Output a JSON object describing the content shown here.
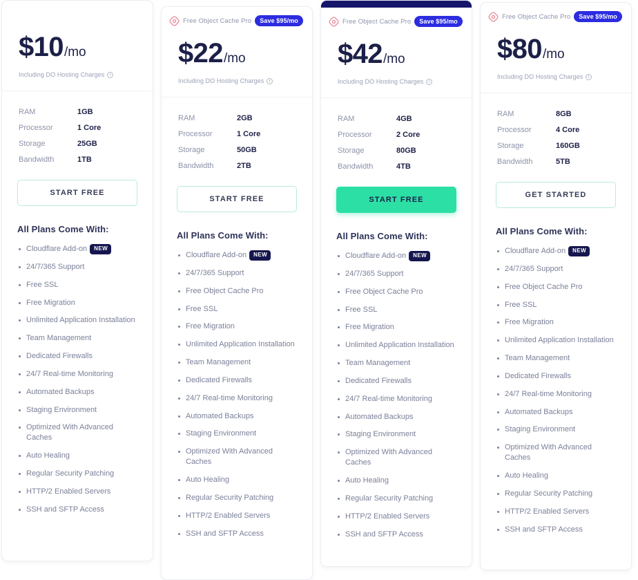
{
  "colors": {
    "accent_green": "#2ce0a5",
    "badge_blue": "#2c2ce0",
    "navy": "#16164f",
    "text_dark": "#1c2048",
    "text_muted": "#8d92a9"
  },
  "labels": {
    "price_suffix": "/mo",
    "price_note": "Including DO Hosting Charges",
    "info_icon": "i",
    "features_title": "All Plans Come With:",
    "ocp_badge_label": "Free Object Cache Pro",
    "ocp_badge_save": "Save $95/mo",
    "new_pill": "NEW",
    "spec_keys": [
      "RAM",
      "Processor",
      "Storage",
      "Bandwidth"
    ]
  },
  "plans": [
    {
      "id": "plan-10",
      "price": "$10",
      "has_ocp_badge": false,
      "highlighted": false,
      "cta": "START FREE",
      "cta_style": "outline",
      "specs": {
        "ram": "1GB",
        "processor": "1 Core",
        "storage": "25GB",
        "bandwidth": "1TB"
      },
      "features": [
        "Cloudflare Add-on",
        "24/7/365 Support",
        "Free SSL",
        "Free Migration",
        "Unlimited Application Installation",
        "Team Management",
        "Dedicated Firewalls",
        "24/7 Real-time Monitoring",
        "Automated Backups",
        "Staging Environment",
        "Optimized With Advanced Caches",
        "Auto Healing",
        "Regular Security Patching",
        "HTTP/2 Enabled Servers",
        "SSH and SFTP Access"
      ]
    },
    {
      "id": "plan-22",
      "price": "$22",
      "has_ocp_badge": true,
      "highlighted": false,
      "cta": "START FREE",
      "cta_style": "outline",
      "specs": {
        "ram": "2GB",
        "processor": "1 Core",
        "storage": "50GB",
        "bandwidth": "2TB"
      },
      "features": [
        "Cloudflare Add-on",
        "24/7/365 Support",
        "Free Object Cache Pro",
        "Free SSL",
        "Free Migration",
        "Unlimited Application Installation",
        "Team Management",
        "Dedicated Firewalls",
        "24/7 Real-time Monitoring",
        "Automated Backups",
        "Staging Environment",
        "Optimized With Advanced Caches",
        "Auto Healing",
        "Regular Security Patching",
        "HTTP/2 Enabled Servers",
        "SSH and SFTP Access"
      ]
    },
    {
      "id": "plan-42",
      "price": "$42",
      "has_ocp_badge": true,
      "highlighted": true,
      "cta": "START FREE",
      "cta_style": "solid",
      "specs": {
        "ram": "4GB",
        "processor": "2 Core",
        "storage": "80GB",
        "bandwidth": "4TB"
      },
      "features": [
        "Cloudflare Add-on",
        "24/7/365 Support",
        "Free Object Cache Pro",
        "Free SSL",
        "Free Migration",
        "Unlimited Application Installation",
        "Team Management",
        "Dedicated Firewalls",
        "24/7 Real-time Monitoring",
        "Automated Backups",
        "Staging Environment",
        "Optimized With Advanced Caches",
        "Auto Healing",
        "Regular Security Patching",
        "HTTP/2 Enabled Servers",
        "SSH and SFTP Access"
      ]
    },
    {
      "id": "plan-80",
      "price": "$80",
      "has_ocp_badge": true,
      "highlighted": false,
      "cta": "GET STARTED",
      "cta_style": "outline",
      "specs": {
        "ram": "8GB",
        "processor": "4 Core",
        "storage": "160GB",
        "bandwidth": "5TB"
      },
      "features": [
        "Cloudflare Add-on",
        "24/7/365 Support",
        "Free Object Cache Pro",
        "Free SSL",
        "Free Migration",
        "Unlimited Application Installation",
        "Team Management",
        "Dedicated Firewalls",
        "24/7 Real-time Monitoring",
        "Automated Backups",
        "Staging Environment",
        "Optimized With Advanced Caches",
        "Auto Healing",
        "Regular Security Patching",
        "HTTP/2 Enabled Servers",
        "SSH and SFTP Access"
      ]
    }
  ]
}
